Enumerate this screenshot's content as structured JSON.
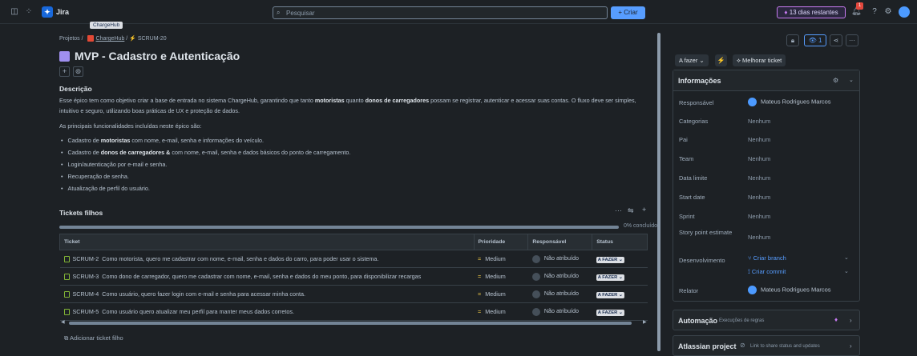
{
  "topbar": {
    "app_name": "Jira",
    "tooltip": "ChargeHub",
    "search_placeholder": "Pesquisar",
    "create_label": "+ Criar",
    "trial_label": "13 dias restantes",
    "notification_count": "1"
  },
  "breadcrumb": {
    "projects": "Projetos",
    "project": "ChargeHub",
    "issue": "SCRUM-20"
  },
  "issue": {
    "title": "MVP - Cadastro e Autenticação",
    "description_heading": "Descrição",
    "para1_a": "Esse épico tem como objetivo criar a base de entrada no sistema ChargeHub, garantindo que tanto ",
    "para1_b": "motoristas",
    "para1_c": " quanto ",
    "para1_d": "donos de carregadores",
    "para1_e": " possam se registrar, autenticar e acessar suas contas. O fluxo deve ser simples, intuitivo e seguro, utilizando boas práticas de UX e proteção de dados.",
    "para2": "As principais funcionalidades incluídas neste épico são:",
    "bullets": [
      {
        "pre": "Cadastro de ",
        "bold": "motoristas",
        "post": " com nome, e-mail, senha e informações do veículo."
      },
      {
        "pre": "Cadastro de ",
        "bold": "donos de carregadores &",
        "post": "  com nome, e-mail, senha e dados básicos do ponto de carregamento."
      },
      {
        "pre": "Login/autenticação por e-mail e senha.",
        "bold": "",
        "post": ""
      },
      {
        "pre": "Recuperação de senha.",
        "bold": "",
        "post": ""
      },
      {
        "pre": "Atualização de perfil do usuário.",
        "bold": "",
        "post": ""
      }
    ]
  },
  "child_tickets": {
    "heading": "Tickets filhos",
    "progress_label": "0% concluído",
    "progress": 0,
    "columns": [
      "Ticket",
      "Prioridade",
      "Responsável",
      "Status"
    ],
    "rows": [
      {
        "key": "SCRUM-2",
        "summary": "Como motorista, quero me cadastrar com nome, e-mail, senha e dados do carro, para poder usar o sistema.",
        "priority": "Medium",
        "assignee": "Não atribuído",
        "status": "A FAZER ⌄"
      },
      {
        "key": "SCRUM-3",
        "summary": "Como dono de carregador, quero me cadastrar com nome, e-mail, senha e dados do meu ponto, para disponibilizar recargas",
        "priority": "Medium",
        "assignee": "Não atribuído",
        "status": "A FAZER ⌄"
      },
      {
        "key": "SCRUM-4",
        "summary": "Como usuário, quero fazer login com e-mail e senha para acessar minha conta.",
        "priority": "Medium",
        "assignee": "Não atribuído",
        "status": "A FAZER ⌄"
      },
      {
        "key": "SCRUM-5",
        "summary": "Como usuário quero atualizar meu perfil para manter meus dados corretos.",
        "priority": "Medium",
        "assignee": "Não atribuído",
        "status": "A FAZER ⌄"
      }
    ],
    "add_label": "Adicionar ticket filho"
  },
  "right": {
    "watch_count": "1",
    "state_label": "A fazer ⌄",
    "improve_label": "Melhorar ticket",
    "info_heading": "Informações",
    "fields": [
      {
        "label": "Responsável",
        "value": "Mateus Rodrigues Marcos"
      },
      {
        "label": "Categorias",
        "value": "Nenhum"
      },
      {
        "label": "Pai",
        "value": "Nenhum"
      },
      {
        "label": "Team",
        "value": "Nenhum"
      },
      {
        "label": "Data limite",
        "value": "Nenhum"
      },
      {
        "label": "Start date",
        "value": "Nenhum"
      },
      {
        "label": "Sprint",
        "value": "Nenhum"
      },
      {
        "label": "Story point estimate",
        "value": "Nenhum"
      },
      {
        "label": "Desenvolvimento",
        "value": "Criar branch",
        "value2": "Criar commit"
      },
      {
        "label": "Relator",
        "value": "Mateus Rodrigues Marcos"
      }
    ],
    "automation_heading": "Automação",
    "automation_sub": "Execuções de regras",
    "atlassian_heading": "Atlassian project",
    "atlassian_sub": "Link to share status and updates"
  }
}
